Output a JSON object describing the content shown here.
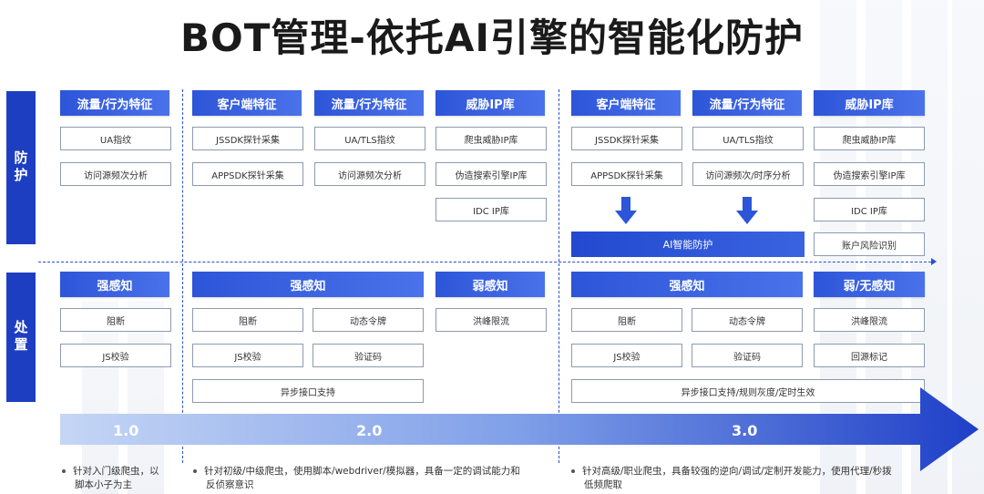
{
  "title": "BOT管理-依托AI引擎的智能化防护",
  "side": {
    "defense": "防护",
    "handling": "处置"
  },
  "defense": {
    "col1": {
      "header": "流量/行为特征",
      "items": [
        "UA指纹",
        "访问源频次分析"
      ]
    },
    "col2": {
      "header": "客户端特征",
      "items": [
        "JSSDK探针采集",
        "APPSDK探针采集"
      ]
    },
    "col3": {
      "header": "流量/行为特征",
      "items": [
        "UA/TLS指纹",
        "访问源频次分析"
      ]
    },
    "col4": {
      "header": "威胁IP库",
      "items": [
        "爬虫威胁IP库",
        "伪造搜索引擎IP库",
        "IDC IP库"
      ]
    },
    "col5": {
      "header": "客户端特征",
      "items": [
        "JSSDK探针采集",
        "APPSDK探针采集"
      ]
    },
    "col6": {
      "header": "流量/行为特征",
      "items": [
        "UA/TLS指纹",
        "访问源频次/时序分析"
      ]
    },
    "col7": {
      "header": "威胁IP库",
      "items": [
        "爬虫威胁IP库",
        "伪造搜索引擎IP库",
        "IDC IP库",
        "账户风险识别"
      ]
    },
    "ai_bar": "AI智能防护"
  },
  "handling": {
    "g1": {
      "header": "强感知",
      "items": [
        "阻断",
        "JS校验"
      ]
    },
    "g2": {
      "header": "强感知",
      "items": [
        "阻断",
        "动态令牌",
        "JS校验",
        "验证码"
      ],
      "wide": "异步接口支持"
    },
    "g3": {
      "header": "弱感知",
      "items": [
        "洪峰限流"
      ]
    },
    "g4": {
      "header": "强感知",
      "items": [
        "阻断",
        "动态令牌",
        "JS校验",
        "验证码"
      ]
    },
    "g5": {
      "header": "弱/无感知",
      "items": [
        "洪峰限流",
        "回源标记"
      ]
    },
    "wide2": "异步接口支持/规则灰度/定时生效"
  },
  "stages": [
    "1.0",
    "2.0",
    "3.0"
  ],
  "notes": [
    [
      "针对入门级爬虫，以",
      "脚本小子为主"
    ],
    [
      "针对初级/中级爬虫，使用脚本/webdriver/模拟器，具备一定的调试能力和",
      "反侦察意识"
    ],
    [
      "针对高级/职业爬虫，具备较强的逆向/调试/定制开发能力，使用代理/秒拨",
      "低频爬取"
    ]
  ],
  "colors": {
    "accent": "#2d55d8",
    "side": "#1e3ec2"
  }
}
